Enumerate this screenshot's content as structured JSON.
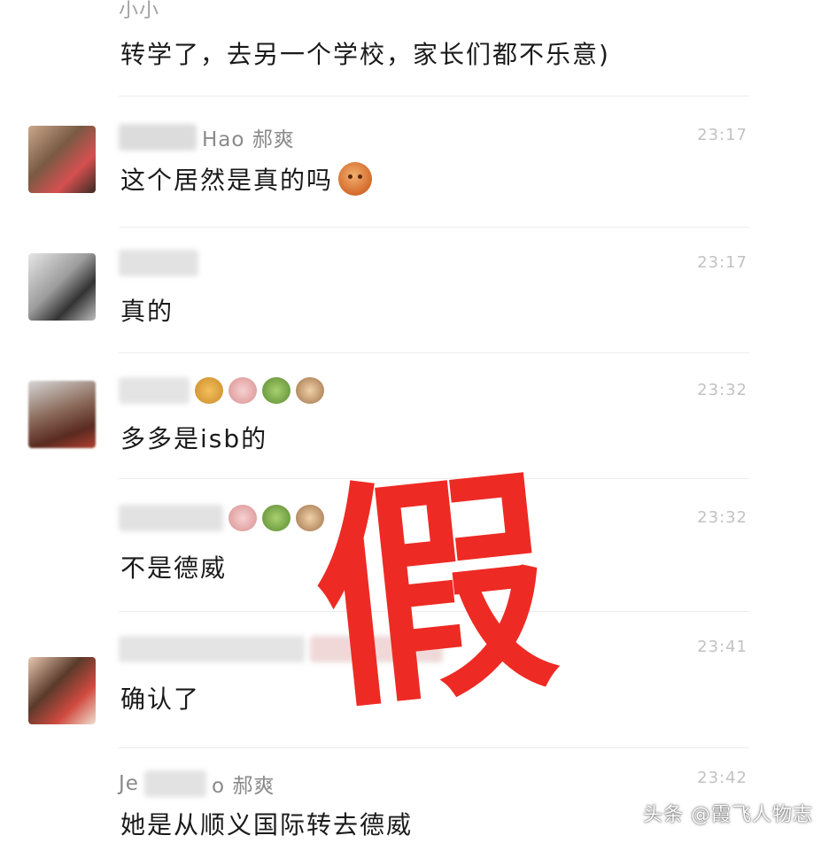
{
  "messages": [
    {
      "sender": "小小",
      "time": "",
      "text": "转学了，去另一个学校，家长们都不乐意)"
    },
    {
      "sender": "Hao 郝爽",
      "time": "23:17",
      "text": "这个居然是真的吗"
    },
    {
      "sender": "",
      "time": "23:17",
      "text": "真的"
    },
    {
      "sender": "",
      "time": "23:32",
      "text": "多多是isb的"
    },
    {
      "sender": "",
      "time": "23:32",
      "text": "不是德威"
    },
    {
      "sender": "",
      "time": "23:41",
      "text": "确认了"
    },
    {
      "sender_prefix": "Je",
      "sender_suffix": "o 郝爽",
      "time": "23:42",
      "text": "她是从顺义国际转去德威"
    }
  ],
  "emoji_icons": [
    "tiger-face-icon",
    "pig-face-icon",
    "dragon-face-icon",
    "monkey-face-icon"
  ],
  "stamp": {
    "text": "假",
    "color": "#ee2a24"
  },
  "watermark": "头条 @霞飞人物志"
}
